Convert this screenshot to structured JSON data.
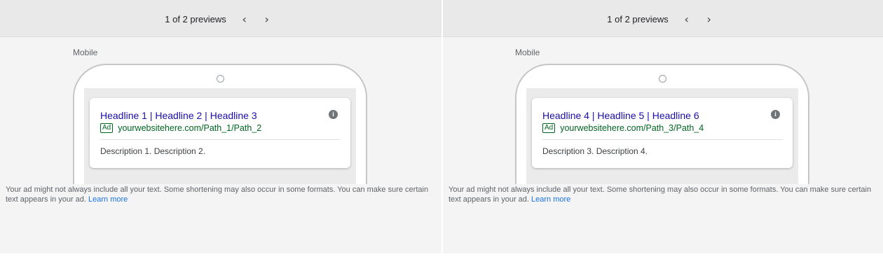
{
  "panels": [
    {
      "pager": {
        "count_text": "1 of 2 previews",
        "prev_icon": "chevron-left-icon",
        "next_icon": "chevron-right-icon"
      },
      "device_label": "Mobile",
      "ad": {
        "headline": "Headline 1 | Headline 2 | Headline 3",
        "badge": "Ad",
        "display_url": "yourwebsitehere.com/Path_1/Path_2",
        "description": "Description 1. Description 2.",
        "info_icon": "i"
      },
      "notice": {
        "text": "Your ad might not always include all your text. Some shortening may also occur in some formats. You can make sure certain text appears in your ad.",
        "link": "Learn more"
      }
    },
    {
      "pager": {
        "count_text": "1 of 2 previews",
        "prev_icon": "chevron-left-icon",
        "next_icon": "chevron-right-icon"
      },
      "device_label": "Mobile",
      "ad": {
        "headline": "Headline 4 | Headline 5 | Headline 6",
        "badge": "Ad",
        "display_url": "yourwebsitehere.com/Path_3/Path_4",
        "description": "Description 3. Description 4.",
        "info_icon": "i"
      },
      "notice": {
        "text": "Your ad might not always include all your text. Some shortening may also occur in some formats. You can make sure certain text appears in your ad.",
        "link": "Learn more"
      }
    }
  ],
  "colors": {
    "headline": "#1a0dab",
    "url": "#006621",
    "link": "#1a73e8"
  }
}
